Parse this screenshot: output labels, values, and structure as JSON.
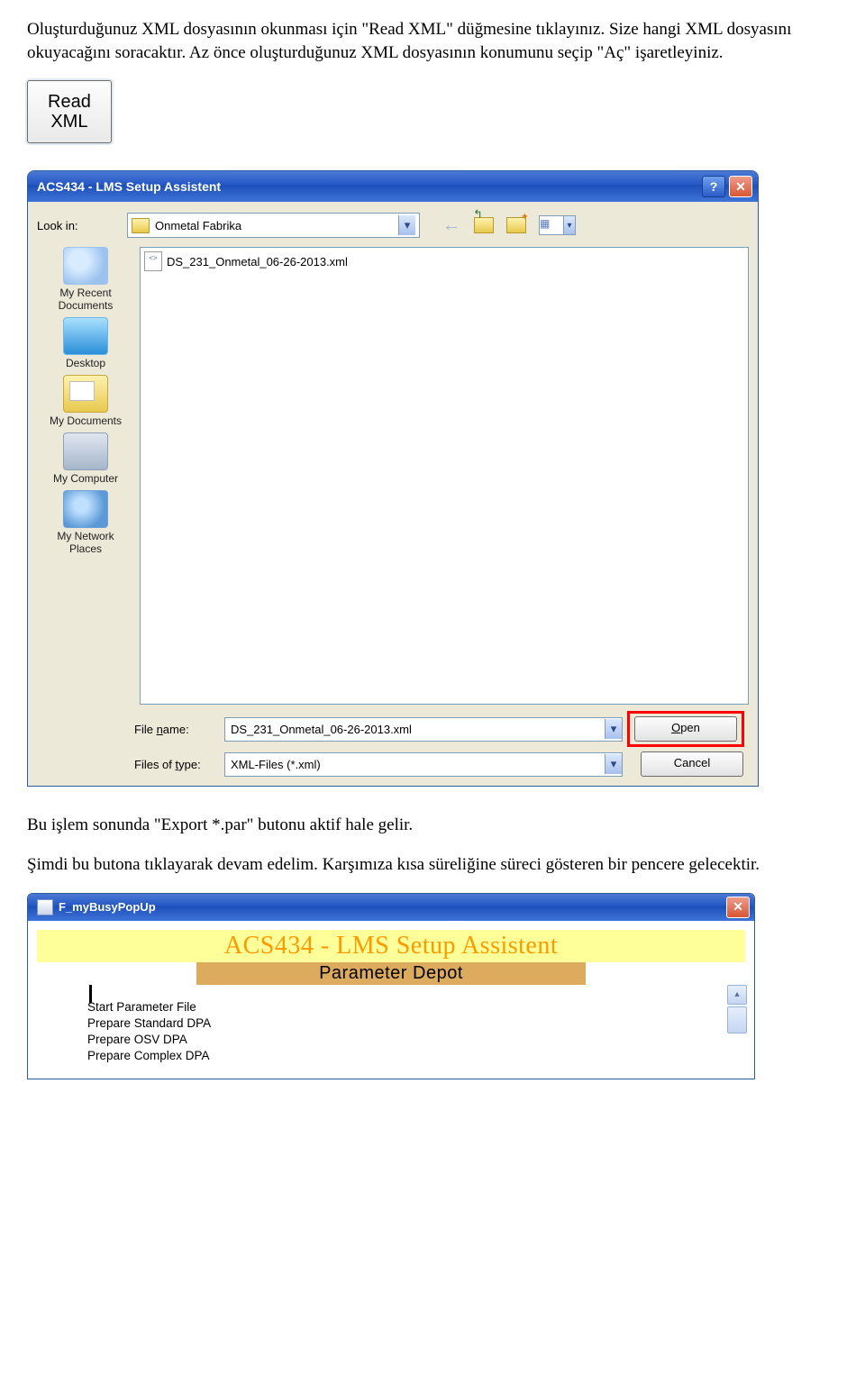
{
  "intro_paragraph": "Oluşturduğunuz XML dosyasının okunması için \"Read XML\" düğmesine tıklayınız. Size hangi XML dosyasını okuyacağını soracaktır. Az önce oluşturduğunuz XML dosyasının konumunu seçip \"Aç\" işaretleyiniz.",
  "read_button": {
    "line1": "Read",
    "line2": "XML"
  },
  "dialog": {
    "title": "ACS434 - LMS Setup Assistent",
    "help_symbol": "?",
    "close_symbol": "✕",
    "lookin_label": "Look in:",
    "lookin_value": "Onmetal Fabrika",
    "file_item": "DS_231_Onmetal_06-26-2013.xml",
    "places": {
      "recent": "My Recent Documents",
      "desktop": "Desktop",
      "docs": "My Documents",
      "computer": "My Computer",
      "network": "My Network Places"
    },
    "filename_label_prefix": "File ",
    "filename_label_u": "n",
    "filename_label_suffix": "ame:",
    "filetype_label_prefix": "Files of ",
    "filetype_label_u": "t",
    "filetype_label_suffix": "ype:",
    "filename_value": "DS_231_Onmetal_06-26-2013.xml",
    "filetype_value": "XML-Files (*.xml)",
    "open_u": "O",
    "open_rest": "pen",
    "cancel": "Cancel"
  },
  "mid_para1": "Bu işlem sonunda \"Export *.par\" butonu aktif hale gelir.",
  "mid_para2": "Şimdi bu butona tıklayarak devam edelim. Karşımıza kısa süreliğine süreci gösteren bir pencere gelecektir.",
  "busy": {
    "window_title": "F_myBusyPopUp",
    "close_symbol": "✕",
    "banner1": "ACS434 - LMS Setup Assistent",
    "banner2": "Parameter Depot",
    "log": {
      "l1": "Start Parameter File",
      "l2": "Prepare Standard DPA",
      "l3": "Prepare OSV DPA",
      "l4": "Prepare Complex DPA"
    },
    "scroll_up": "▴",
    "scroll_thumb": "▪",
    "cursor": "▍"
  }
}
